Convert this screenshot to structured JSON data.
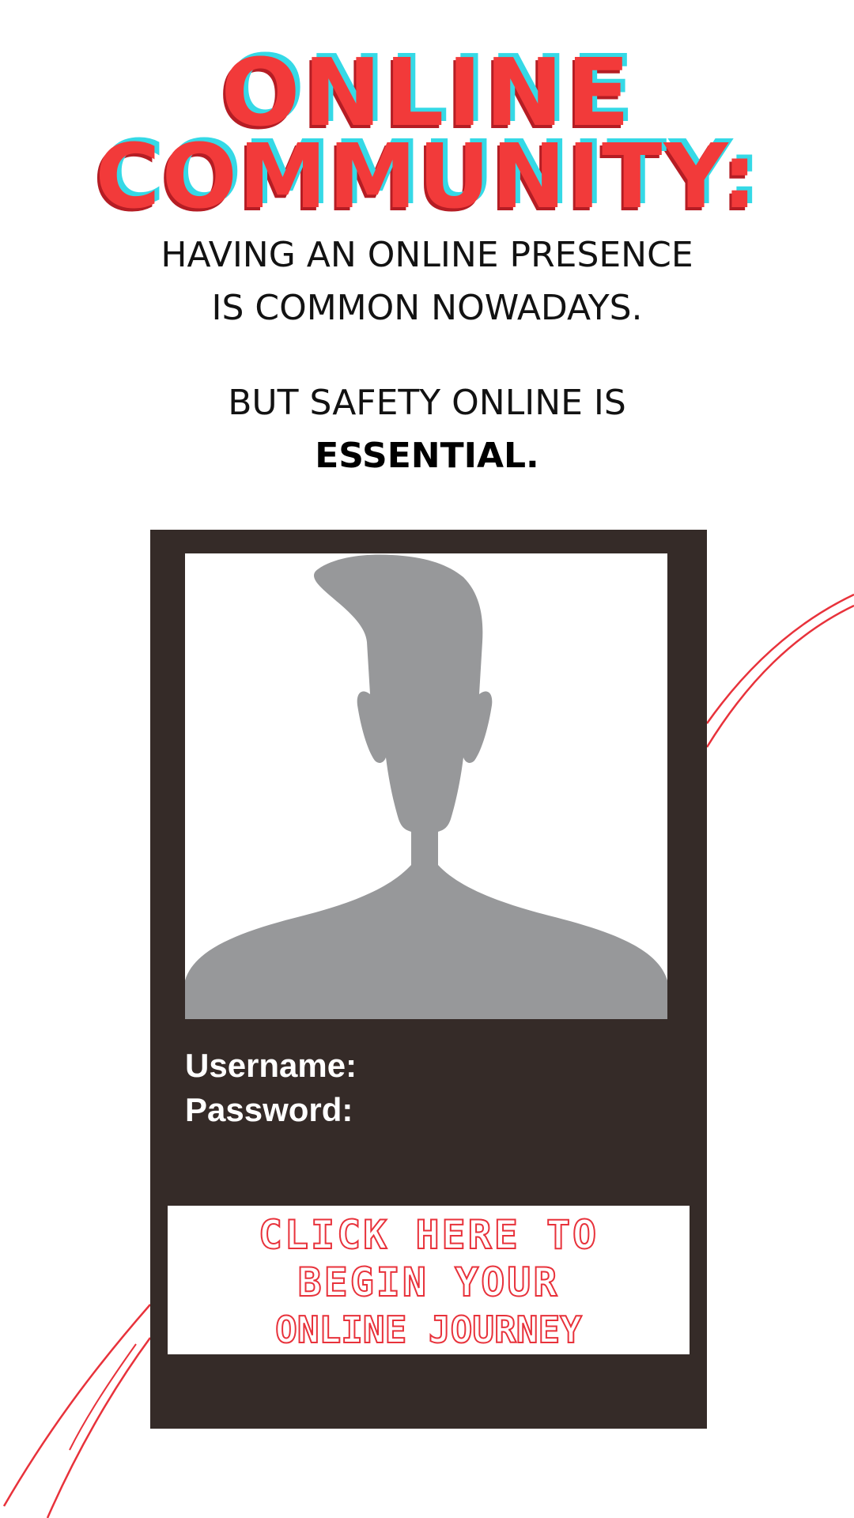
{
  "title": {
    "line1": "ONLINE",
    "line2": "COMMUNITY:"
  },
  "intro": {
    "line1": "HAVING AN ONLINE PRESENCE",
    "line2": "IS COMMON NOWADAYS.",
    "line3": "BUT SAFETY ONLINE IS",
    "line4": "ESSENTIAL."
  },
  "profile_card": {
    "avatar_icon": "person-silhouette-icon",
    "username_label": "Username:",
    "password_label": "Password:",
    "cta": {
      "line1": "CLICK HERE TO",
      "line2": "BEGIN YOUR",
      "line3": "ONLINE JOURNEY"
    }
  },
  "colors": {
    "accent_red": "#f23a3a",
    "accent_cyan": "#35d9e6",
    "card_background": "#352b28",
    "silhouette_gray": "#97989a"
  }
}
